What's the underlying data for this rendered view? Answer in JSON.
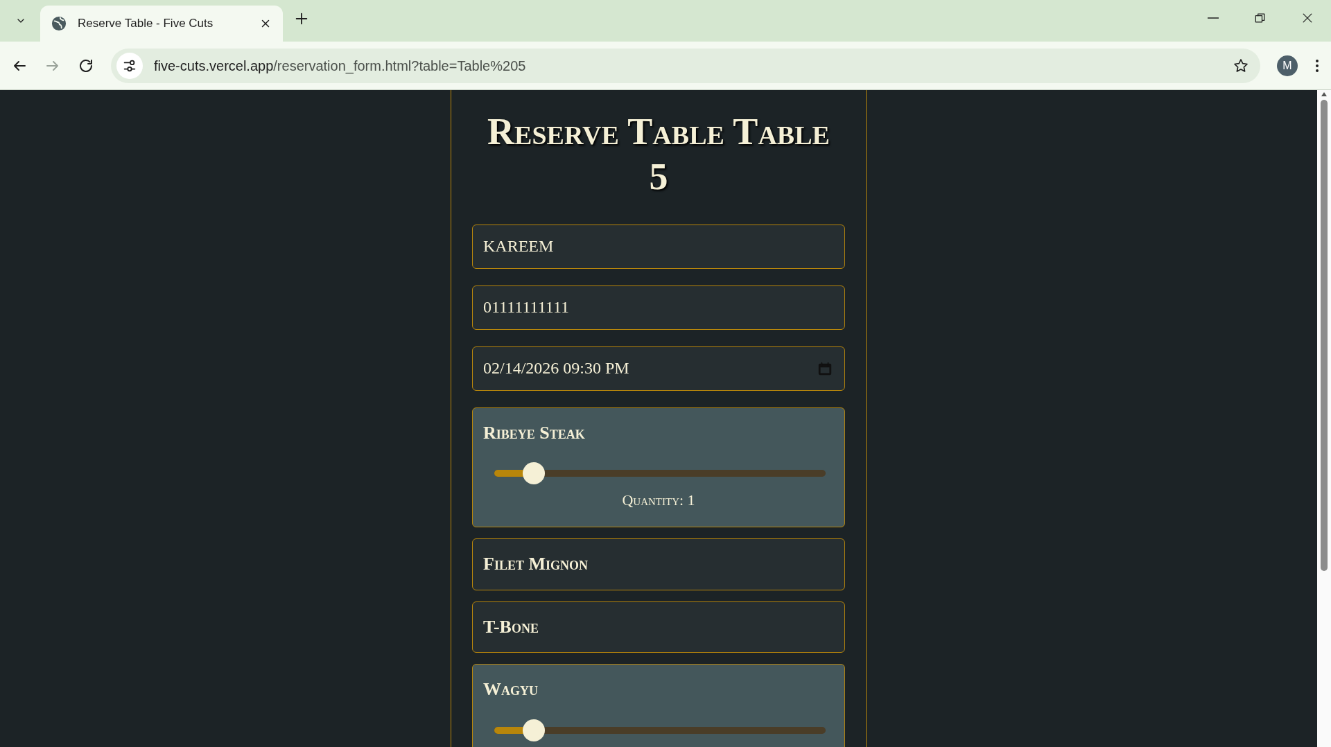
{
  "browser": {
    "tab_title": "Reserve Table - Five Cuts",
    "url_host": "five-cuts.vercel.app",
    "url_path": "/reservation_form.html?table=Table%205",
    "profile_initial": "M"
  },
  "form": {
    "title": "Reserve Table Table 5",
    "name_value": "KAREEM",
    "phone_value": "01111111111",
    "datetime_value": "02/14/2026 09:30 PM"
  },
  "items": [
    {
      "name": "Ribeye Steak",
      "selected": true,
      "level": 0.12,
      "quantity": "Quantity: 1"
    },
    {
      "name": "Filet Mignon",
      "selected": false
    },
    {
      "name": "T-Bone",
      "selected": false
    },
    {
      "name": "Wagyu",
      "selected": true,
      "level": 0.12
    }
  ]
}
